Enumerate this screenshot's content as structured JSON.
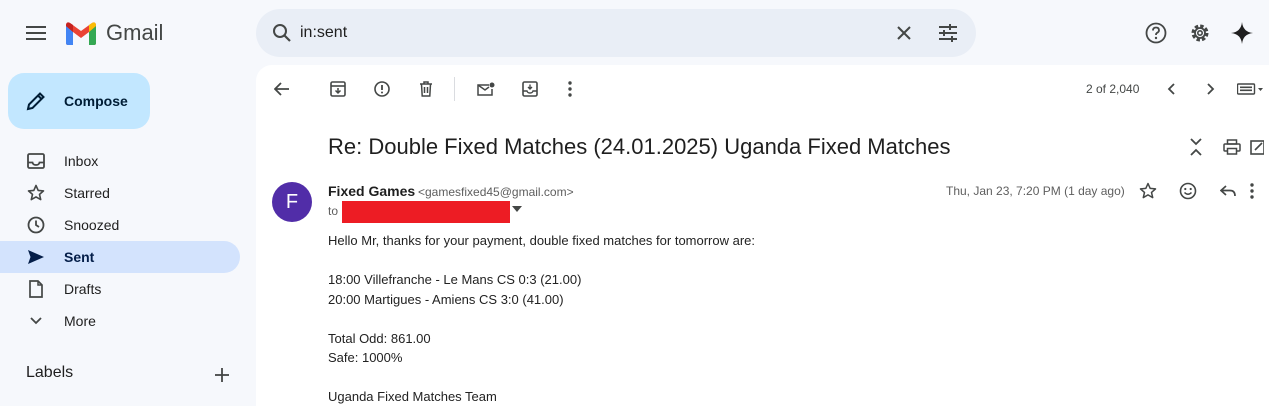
{
  "header": {
    "logo_text": "Gmail",
    "search_value": "in:sent"
  },
  "sidebar": {
    "compose_label": "Compose",
    "items": [
      {
        "label": "Inbox",
        "icon": "inbox-icon"
      },
      {
        "label": "Starred",
        "icon": "star-icon"
      },
      {
        "label": "Snoozed",
        "icon": "clock-icon"
      },
      {
        "label": "Sent",
        "icon": "send-icon",
        "active": true
      },
      {
        "label": "Drafts",
        "icon": "draft-icon"
      },
      {
        "label": "More",
        "icon": "chevron-down-icon"
      }
    ],
    "labels_heading": "Labels"
  },
  "toolbar": {
    "pager": "2 of 2,040"
  },
  "email": {
    "subject": "Re: Double Fixed Matches (24.01.2025) Uganda Fixed Matches",
    "avatar_letter": "F",
    "sender_name": "Fixed Games",
    "sender_email": "<gamesfixed45@gmail.com>",
    "to_label": "to",
    "date": "Thu, Jan 23, 7:20 PM (1 day ago)",
    "body_lines": [
      "Hello Mr, thanks for your payment, double fixed matches for tomorrow are:",
      "",
      "18:00 Villefranche - Le Mans CS 0:3 (21.00)",
      "20:00 Martigues - Amiens CS 3:0 (41.00)",
      "",
      "Total Odd: 861.00",
      "Safe: 1000%",
      "",
      "Uganda Fixed Matches Team"
    ]
  },
  "colors": {
    "background": "#f6f8fc",
    "search_bg": "#e9eef6",
    "compose_bg": "#c2e7ff",
    "active_nav_bg": "#d3e3fd",
    "avatar_bg": "#512da8",
    "redaction": "#ed1c24"
  }
}
